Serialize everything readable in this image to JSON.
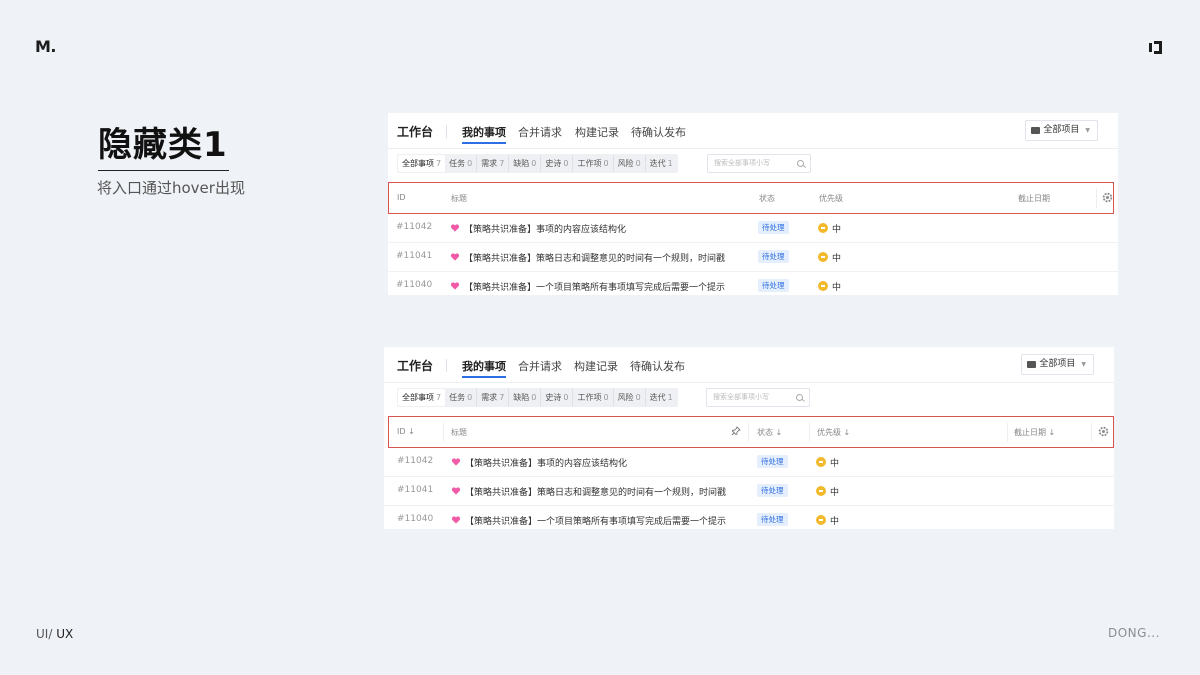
{
  "slide": {
    "logo": "M.",
    "title": "隐藏类1",
    "subtitle": "将入口通过hover出现",
    "footer_left_a": "UI/ ",
    "footer_left_b": "UX",
    "footer_right": "DONG..."
  },
  "panels": [
    {
      "workspace_title": "工作台",
      "tabs": [
        "我的事项",
        "合并请求",
        "构建记录",
        "待确认发布"
      ],
      "project_selector": "全部项目",
      "filters": [
        {
          "label": "全部事项",
          "count": "7"
        },
        {
          "label": "任务",
          "count": "0"
        },
        {
          "label": "需求",
          "count": "7"
        },
        {
          "label": "缺陷",
          "count": "0"
        },
        {
          "label": "史诗",
          "count": "0"
        },
        {
          "label": "工作项",
          "count": "0"
        },
        {
          "label": "风险",
          "count": "0"
        },
        {
          "label": "迭代",
          "count": "1"
        }
      ],
      "search_placeholder": "搜索全部事项小写",
      "columns": {
        "id": "ID",
        "title": "标题",
        "status": "状态",
        "priority": "优先级",
        "due": "截止日期"
      },
      "rows": [
        {
          "id": "#11042",
          "title": "【策略共识准备】事项的内容应该结构化",
          "status": "待处理",
          "priority": "中"
        },
        {
          "id": "#11041",
          "title": "【策略共识准备】策略日志和调整意见的时间有一个规则，时间戳",
          "status": "待处理",
          "priority": "中"
        },
        {
          "id": "#11040",
          "title": "【策略共识准备】一个项目策略所有事项填写完成后需要一个提示",
          "status": "待处理",
          "priority": "中"
        }
      ]
    },
    {
      "workspace_title": "工作台",
      "tabs": [
        "我的事项",
        "合并请求",
        "构建记录",
        "待确认发布"
      ],
      "project_selector": "全部项目",
      "filters": [
        {
          "label": "全部事项",
          "count": "7"
        },
        {
          "label": "任务",
          "count": "0"
        },
        {
          "label": "需求",
          "count": "7"
        },
        {
          "label": "缺陷",
          "count": "0"
        },
        {
          "label": "史诗",
          "count": "0"
        },
        {
          "label": "工作项",
          "count": "0"
        },
        {
          "label": "风险",
          "count": "0"
        },
        {
          "label": "迭代",
          "count": "1"
        }
      ],
      "search_placeholder": "搜索全部事项小写",
      "columns": {
        "id": "ID ↓",
        "title": "标题",
        "status": "状态 ↓",
        "priority": "优先级 ↓",
        "due": "截止日期 ↓"
      },
      "rows": [
        {
          "id": "#11042",
          "title": "【策略共识准备】事项的内容应该结构化",
          "status": "待处理",
          "priority": "中"
        },
        {
          "id": "#11041",
          "title": "【策略共识准备】策略日志和调整意见的时间有一个规则，时间戳",
          "status": "待处理",
          "priority": "中"
        },
        {
          "id": "#11040",
          "title": "【策略共识准备】一个项目策略所有事项填写完成后需要一个提示",
          "status": "待处理",
          "priority": "中"
        }
      ]
    }
  ]
}
